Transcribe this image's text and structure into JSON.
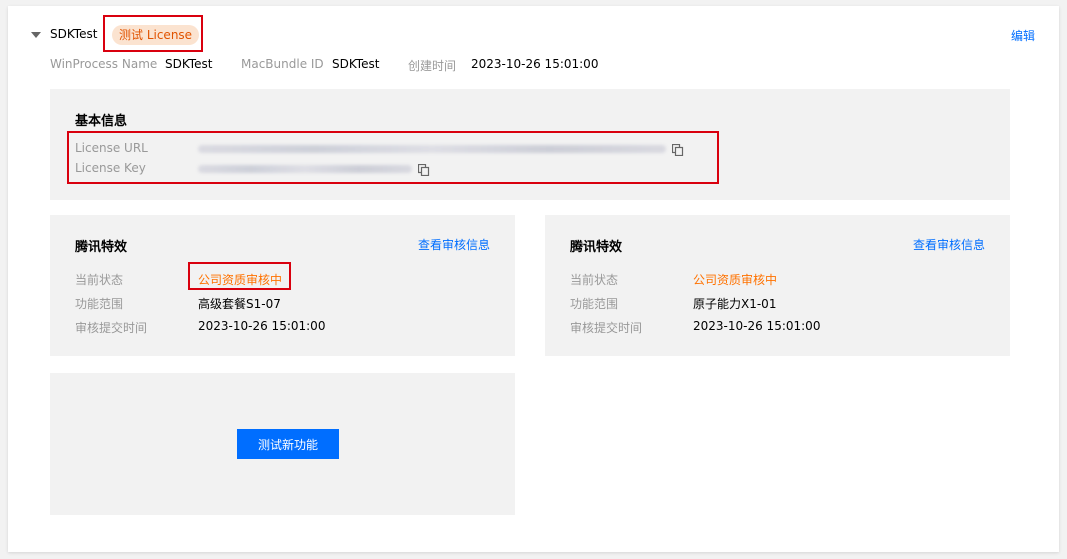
{
  "header": {
    "app_name": "SDKTest",
    "badge": "测试 License",
    "edit": "编辑",
    "meta": [
      {
        "label": "WinProcess Name",
        "value": "SDKTest"
      },
      {
        "label": "MacBundle ID",
        "value": "SDKTest"
      },
      {
        "label": "创建时间",
        "value": "2023-10-26 15:01:00"
      }
    ]
  },
  "basic_info": {
    "title": "基本信息",
    "license_url_label": "License URL",
    "license_key_label": "License Key"
  },
  "effects": [
    {
      "title": "腾讯特效",
      "link": "查看审核信息",
      "status_label": "当前状态",
      "status_value": "公司资质审核中",
      "scope_label": "功能范围",
      "scope_value": "高级套餐S1-07",
      "time_label": "审核提交时间",
      "time_value": "2023-10-26 15:01:00"
    },
    {
      "title": "腾讯特效",
      "link": "查看审核信息",
      "status_label": "当前状态",
      "status_value": "公司资质审核中",
      "scope_label": "功能范围",
      "scope_value": "原子能力X1-01",
      "time_label": "审核提交时间",
      "time_value": "2023-10-26 15:01:00"
    }
  ],
  "test_panel": {
    "button": "测试新功能"
  },
  "colors": {
    "accent": "#006eff",
    "status": "#ff7200",
    "highlight_border": "#d9000e"
  }
}
